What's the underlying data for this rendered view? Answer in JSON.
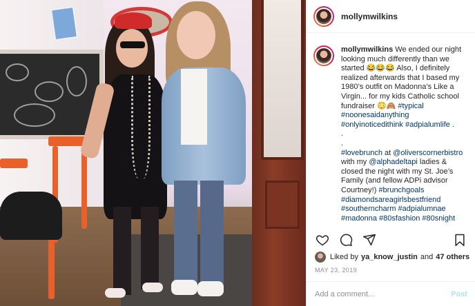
{
  "post": {
    "username": "mollymwilkins",
    "caption": {
      "username": "mollymwilkins",
      "lines": [
        {
          "text": "We ended our night looking much differently than we started 😂😂😂 Also, I definitely realized afterwards that I based my 1980’s outfit on Madonna’s Like a Virgin... for my kids Catholic school fundraiser 😳🙈 ",
          "tag": "#typical"
        },
        {
          "text": "",
          "tag": "#noonesaidanything"
        },
        {
          "text": "",
          "tag": "#onlyinoticedithink #adpialumlife"
        },
        {
          "text": ".",
          "tag": ""
        },
        {
          "text": ".",
          "tag": ""
        }
      ],
      "para2": {
        "tag1": "#lovebrunch",
        "text1": " at ",
        "tag2": "@oliverscornerbistro",
        "text2": " with my ",
        "tag3": "@alphadeltapi",
        "text3": " ladies & closed the night with my St. Joe’s Family (and fellow ADPi advisor Courtney!) ",
        "tag4": "#brunchgoals #diamondsareagirlsbestfriend #southerncharm #adpialumnae #madonna #80sfashion #80snight"
      },
      "trail": " ."
    },
    "likes": {
      "prefix": "Liked by",
      "user": "ya_know_justin",
      "and": "and",
      "count": "47 others"
    },
    "date": "MAY 23, 2019",
    "comment": {
      "placeholder": "Add a comment...",
      "post_label": "Post"
    }
  },
  "icons": [
    "heart-icon",
    "comment-icon",
    "share-icon",
    "bookmark-icon"
  ],
  "colors": {
    "link": "#00376b",
    "post_disabled": "#b2dffc",
    "meta": "#8e8e8e"
  }
}
